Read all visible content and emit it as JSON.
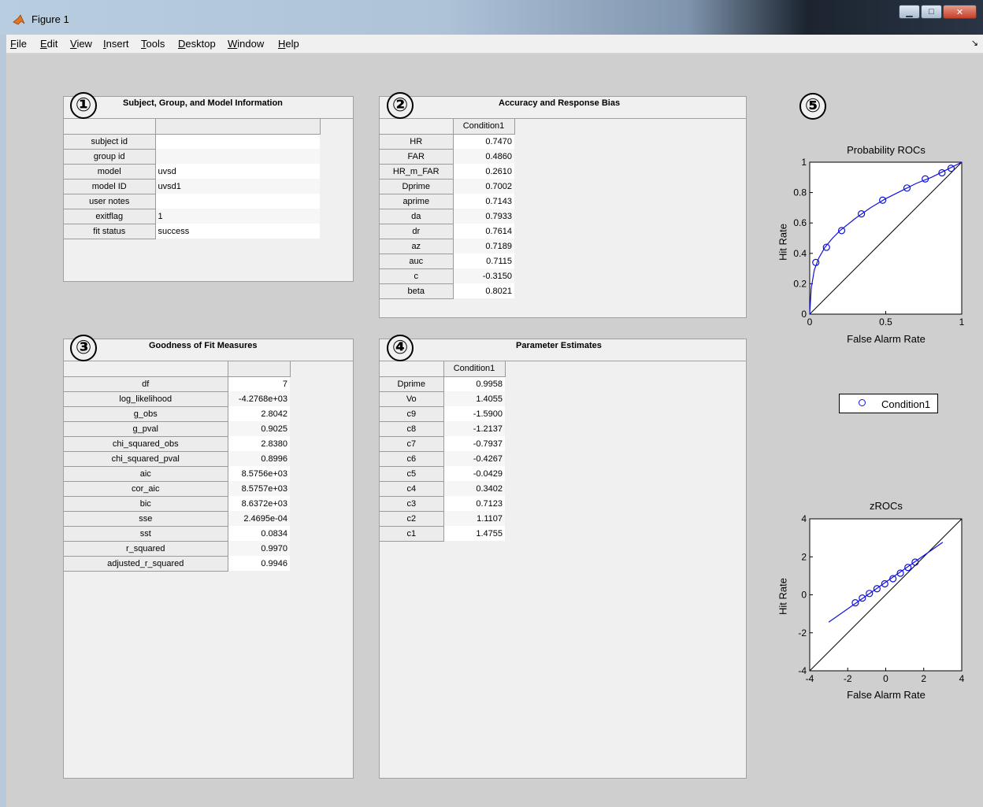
{
  "window": {
    "title": "Figure 1"
  },
  "menu": [
    {
      "label": "File",
      "u": "F",
      "rest": "ile"
    },
    {
      "label": "Edit",
      "u": "E",
      "rest": "dit"
    },
    {
      "label": "View",
      "u": "V",
      "rest": "iew"
    },
    {
      "label": "Insert",
      "u": "I",
      "rest": "nsert"
    },
    {
      "label": "Tools",
      "u": "T",
      "rest": "ools"
    },
    {
      "label": "Desktop",
      "u": "D",
      "rest": "esktop"
    },
    {
      "label": "Window",
      "u": "W",
      "rest": "indow"
    },
    {
      "label": "Help",
      "u": "H",
      "rest": "elp"
    }
  ],
  "panel1": {
    "number": "①",
    "title": "Subject, Group, and Model Information",
    "rows": [
      {
        "label": "subject id",
        "value": ""
      },
      {
        "label": "group id",
        "value": ""
      },
      {
        "label": "model",
        "value": "uvsd"
      },
      {
        "label": "model ID",
        "value": "uvsd1"
      },
      {
        "label": "user notes",
        "value": ""
      },
      {
        "label": "exitflag",
        "value": "1"
      },
      {
        "label": "fit status",
        "value": "success"
      }
    ]
  },
  "panel2": {
    "number": "②",
    "title": "Accuracy and Response Bias",
    "column": "Condition1",
    "rows": [
      {
        "label": "HR",
        "value": "0.7470"
      },
      {
        "label": "FAR",
        "value": "0.4860"
      },
      {
        "label": "HR_m_FAR",
        "value": "0.2610"
      },
      {
        "label": "Dprime",
        "value": "0.7002"
      },
      {
        "label": "aprime",
        "value": "0.7143"
      },
      {
        "label": "da",
        "value": "0.7933"
      },
      {
        "label": "dr",
        "value": "0.7614"
      },
      {
        "label": "az",
        "value": "0.7189"
      },
      {
        "label": "auc",
        "value": "0.7115"
      },
      {
        "label": "c",
        "value": "-0.3150"
      },
      {
        "label": "beta",
        "value": "0.8021"
      }
    ]
  },
  "panel3": {
    "number": "③",
    "title": "Goodness of Fit Measures",
    "rows": [
      {
        "label": "df",
        "value": "7"
      },
      {
        "label": "log_likelihood",
        "value": "-4.2768e+03"
      },
      {
        "label": "g_obs",
        "value": "2.8042"
      },
      {
        "label": "g_pval",
        "value": "0.9025"
      },
      {
        "label": "chi_squared_obs",
        "value": "2.8380"
      },
      {
        "label": "chi_squared_pval",
        "value": "0.8996"
      },
      {
        "label": "aic",
        "value": "8.5756e+03"
      },
      {
        "label": "cor_aic",
        "value": "8.5757e+03"
      },
      {
        "label": "bic",
        "value": "8.6372e+03"
      },
      {
        "label": "sse",
        "value": "2.4695e-04"
      },
      {
        "label": "sst",
        "value": "0.0834"
      },
      {
        "label": "r_squared",
        "value": "0.9970"
      },
      {
        "label": "adjusted_r_squared",
        "value": "0.9946"
      }
    ]
  },
  "panel4": {
    "number": "④",
    "title": "Parameter Estimates",
    "column": "Condition1",
    "rows": [
      {
        "label": "Dprime",
        "value": "0.9958"
      },
      {
        "label": "Vo",
        "value": "1.4055"
      },
      {
        "label": "c9",
        "value": "-1.5900"
      },
      {
        "label": "c8",
        "value": "-1.2137"
      },
      {
        "label": "c7",
        "value": "-0.7937"
      },
      {
        "label": "c6",
        "value": "-0.4267"
      },
      {
        "label": "c5",
        "value": "-0.0429"
      },
      {
        "label": "c4",
        "value": "0.3402"
      },
      {
        "label": "c3",
        "value": "0.7123"
      },
      {
        "label": "c2",
        "value": "1.1107"
      },
      {
        "label": "c1",
        "value": "1.4755"
      }
    ]
  },
  "panel5": {
    "number": "⑤"
  },
  "legend": {
    "label": "Condition1"
  },
  "chart_data": [
    {
      "type": "line",
      "title": "Probability ROCs",
      "xlabel": "False Alarm Rate",
      "ylabel": "Hit Rate",
      "xlim": [
        0,
        1
      ],
      "ylim": [
        0,
        1
      ],
      "xticks": [
        "0",
        "0.5",
        "1"
      ],
      "yticks": [
        "0",
        "0.2",
        "0.4",
        "0.6",
        "0.8",
        "1"
      ],
      "series": [
        {
          "name": "Condition1",
          "points": [
            [
              0.04,
              0.34
            ],
            [
              0.11,
              0.44
            ],
            [
              0.21,
              0.55
            ],
            [
              0.34,
              0.66
            ],
            [
              0.48,
              0.75
            ],
            [
              0.64,
              0.83
            ],
            [
              0.76,
              0.89
            ],
            [
              0.87,
              0.93
            ],
            [
              0.93,
              0.96
            ]
          ]
        }
      ],
      "fit_curve": [
        [
          0,
          0
        ],
        [
          0.01,
          0.17
        ],
        [
          0.03,
          0.29
        ],
        [
          0.06,
          0.37
        ],
        [
          0.1,
          0.44
        ],
        [
          0.15,
          0.5
        ],
        [
          0.2,
          0.55
        ],
        [
          0.3,
          0.63
        ],
        [
          0.4,
          0.7
        ],
        [
          0.5,
          0.76
        ],
        [
          0.6,
          0.81
        ],
        [
          0.7,
          0.86
        ],
        [
          0.8,
          0.9
        ],
        [
          0.9,
          0.95
        ],
        [
          1,
          1
        ]
      ],
      "chance_line": true,
      "color": "#1010e0"
    },
    {
      "type": "line",
      "title": "zROCs",
      "xlabel": "False Alarm Rate",
      "ylabel": "Hit Rate",
      "xlim": [
        -4,
        4
      ],
      "ylim": [
        -4,
        4
      ],
      "xticks": [
        "-4",
        "-2",
        "0",
        "2",
        "4"
      ],
      "yticks": [
        "-4",
        "-2",
        "0",
        "2",
        "4"
      ],
      "series": [
        {
          "name": "Condition1",
          "points": [
            [
              -1.6,
              -0.42
            ],
            [
              -1.23,
              -0.17
            ],
            [
              -0.86,
              0.07
            ],
            [
              -0.46,
              0.32
            ],
            [
              -0.05,
              0.58
            ],
            [
              0.38,
              0.85
            ],
            [
              0.77,
              1.14
            ],
            [
              1.17,
              1.44
            ],
            [
              1.55,
              1.72
            ]
          ]
        }
      ],
      "fit_curve": [
        [
          -3,
          -1.44
        ],
        [
          3,
          2.77
        ]
      ],
      "chance_line": true,
      "color": "#1010e0"
    }
  ]
}
